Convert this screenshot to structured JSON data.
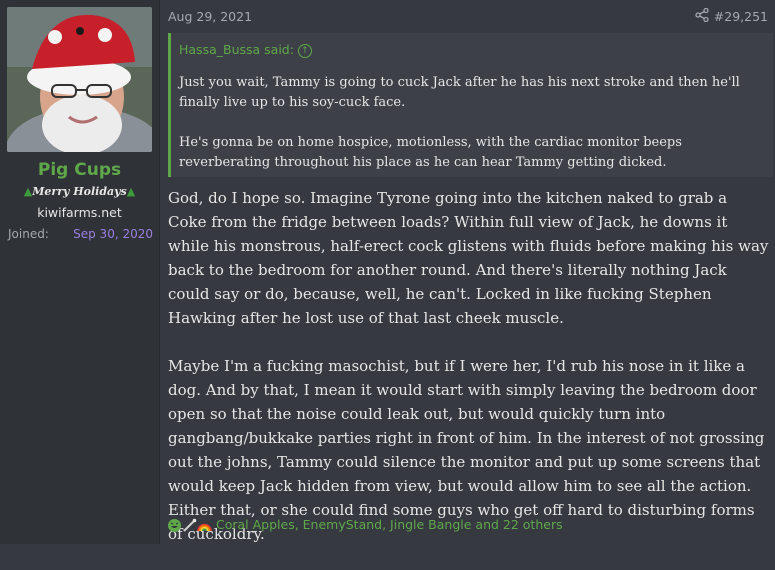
{
  "user": {
    "name": "Pig Cups",
    "title": "Merry Holidays",
    "site": "kiwifarms.net",
    "joined_label": "Joined:",
    "joined_value": "Sep 30, 2020"
  },
  "post": {
    "date": "Aug 29, 2021",
    "number": "#29,251",
    "quote": {
      "author": "Hassa_Bussa said:",
      "paragraphs": [
        "Just you wait, Tammy is going to cuck Jack after he has his next stroke and then he'll finally live up to his soy-cuck face.",
        "He's gonna be on home hospice, motionless, with the cardiac monitor beeps reverberating throughout his place as he can hear Tammy getting dicked."
      ]
    },
    "paragraphs": [
      "God, do I hope so. Imagine Tyrone going into the kitchen naked to grab a Coke from the fridge between loads? Within full view of Jack, he downs it while his monstrous, half-erect cock glistens with fluids before making his way back to the bedroom for another round. And there's literally nothing Jack could say or do, because, well, he can't. Locked in like fucking Stephen Hawking after he lost use of that last cheek muscle.",
      "Maybe I'm a fucking masochist, but if I were her, I'd rub his nose in it like a dog. And by that, I mean it would start with simply leaving the bedroom door open so that the noise could leak out, but would quickly turn into gangbang/bukkake parties right in front of him. In the interest of not grossing out the johns, Tammy could silence the monitor and put up some screens that would keep Jack hidden from view, but would allow him to see all the action. Either that, or she could find some guys who get off hard to disturbing forms of cuckoldry."
    ],
    "reactions": "Coral Apples, EnemyStand, Jingle Bangle and 22 others",
    "reaction_icons": [
      "laughing-icon",
      "wand-icon",
      "rainbow-icon"
    ]
  },
  "colors": {
    "background": "#36393f",
    "sidebar": "#2f3237",
    "accent_green": "#5fa84a",
    "join_date_purple": "#9a7fe0"
  }
}
